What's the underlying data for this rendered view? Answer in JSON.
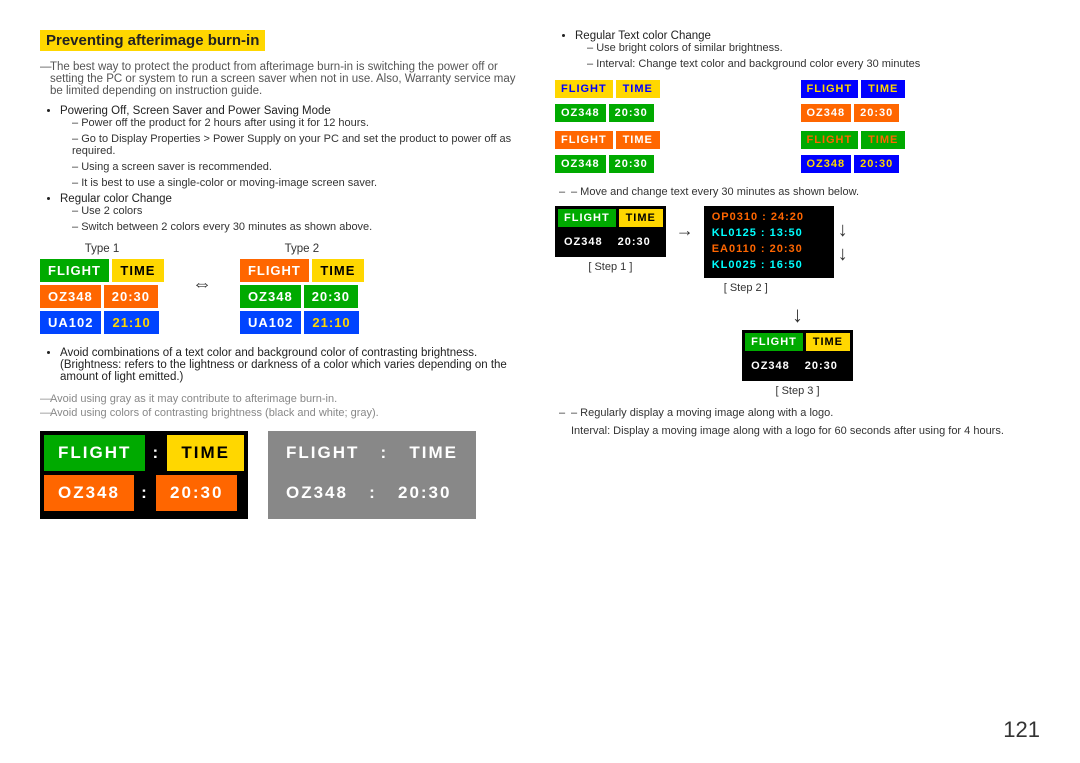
{
  "page": {
    "number": "121"
  },
  "section": {
    "title": "Preventing afterimage burn-in",
    "intro": "The best way to protect the product from afterimage burn-in is switching the power off or setting the PC or system to run a screen saver when not in use. Also, Warranty service may be limited depending on instruction guide.",
    "bullets": [
      {
        "text": "Powering Off, Screen Saver and Power Saving Mode",
        "sub": [
          "Power off the product for 2 hours after using it for 12 hours.",
          "Go to Display Properties > Power Supply on your PC and set the product to power off as required.",
          "Using a screen saver is recommended.",
          "It is best to use a single-color or moving-image screen saver."
        ]
      },
      {
        "text": "Regular color Change",
        "sub": [
          "Use 2 colors",
          "Switch between 2 colors every 30 minutes as shown above."
        ]
      }
    ],
    "avoidance_notes": [
      "Avoid combinations of a text color and background color of contrasting brightness. (Brightness: refers to the lightness or darkness of a color which varies depending on the amount of light emitted.)",
      "Avoid using gray as it may contribute to afterimage burn-in.",
      "Avoid using colors of contrasting brightness (black and white; gray)."
    ]
  },
  "type_labels": {
    "type1": "Type 1",
    "type2": "Type 2"
  },
  "boards": {
    "type1": {
      "row1": [
        "FLIGHT",
        "TIME"
      ],
      "row2": [
        "OZ348",
        "20:30"
      ],
      "row3": [
        "UA102",
        "21:10"
      ],
      "row1_colors": [
        "#00AA00",
        "#FFD700"
      ],
      "row2_colors": [
        "#FF6600",
        "#FF6600"
      ],
      "row3_colors": [
        "#0044FF",
        "#0044FF"
      ],
      "row1_text_colors": [
        "#fff",
        "#000"
      ],
      "row2_text_colors": [
        "#fff",
        "#fff"
      ],
      "row3_text_colors": [
        "#fff",
        "#FFD700"
      ]
    },
    "type2": {
      "row1": [
        "FLIGHT",
        "TIME"
      ],
      "row2": [
        "OZ348",
        "20:30"
      ],
      "row3": [
        "UA102",
        "21:10"
      ],
      "row1_colors": [
        "#FF6600",
        "#FFD700"
      ],
      "row2_colors": [
        "#00AA00",
        "#00AA00"
      ],
      "row3_colors": [
        "#0044FF",
        "#0044FF"
      ],
      "row1_text_colors": [
        "#fff",
        "#000"
      ],
      "row2_text_colors": [
        "#fff",
        "#fff"
      ],
      "row3_text_colors": [
        "#fff",
        "#FFD700"
      ]
    }
  },
  "bottom_boards": {
    "board1": {
      "bg": "#000",
      "row1": [
        "FLIGHT",
        ":",
        "TIME"
      ],
      "row2": [
        "OZ348",
        ":",
        "20:30"
      ],
      "row1_colors": [
        "#00AA00",
        "#000",
        "#FFD700"
      ],
      "row2_colors": [
        "#FF6600",
        "#000",
        "#FF6600"
      ],
      "row1_text": [
        "#fff",
        "#fff",
        "#000"
      ],
      "row2_text": [
        "#fff",
        "#fff",
        "#fff"
      ]
    },
    "board2": {
      "bg": "#888",
      "row1": [
        "FLIGHT",
        ":",
        "TIME"
      ],
      "row2": [
        "OZ348",
        ":",
        "20:30"
      ],
      "row1_colors": [
        "#888",
        "#888",
        "#888"
      ],
      "row2_colors": [
        "#888",
        "#888",
        "#888"
      ],
      "row1_text": [
        "#fff",
        "#fff",
        "#fff"
      ],
      "row2_text": [
        "#fff",
        "#fff",
        "#fff"
      ]
    }
  },
  "right": {
    "bullet": {
      "text": "Regular Text color Change",
      "sub": [
        "Use bright colors of similar brightness.",
        "Interval: Change text color and background color every 30 minutes"
      ]
    },
    "color_boards": [
      {
        "row1_bg": [
          "#FFD700",
          "#FFD700"
        ],
        "row1_text": [
          "#0000FF",
          "#0000FF"
        ],
        "row1_label": [
          "FLIGHT",
          "TIME"
        ],
        "row2_bg": [
          "#00AA00",
          "#00AA00"
        ],
        "row2_text": [
          "#fff",
          "#fff"
        ],
        "row2_label": [
          "OZ348",
          "20:30"
        ]
      },
      {
        "row1_bg": [
          "#0000FF",
          "#0000FF"
        ],
        "row1_text": [
          "#FFD700",
          "#FFD700"
        ],
        "row1_label": [
          "FLIGHT",
          "TIME"
        ],
        "row2_bg": [
          "#FF6600",
          "#FF6600"
        ],
        "row2_text": [
          "#fff",
          "#fff"
        ],
        "row2_label": [
          "OZ348",
          "20:30"
        ]
      },
      {
        "row1_bg": [
          "#FF6600",
          "#FF6600"
        ],
        "row1_text": [
          "#fff",
          "#fff"
        ],
        "row1_label": [
          "FLIGHT",
          "TIME"
        ],
        "row2_bg": [
          "#00AA00",
          "#00AA00"
        ],
        "row2_text": [
          "#fff",
          "#fff"
        ],
        "row2_label": [
          "OZ348",
          "20:30"
        ]
      },
      {
        "row1_bg": [
          "#00AA00",
          "#00AA00"
        ],
        "row1_text": [
          "#FF6600",
          "#FF6600"
        ],
        "row1_label": [
          "FLIGHT",
          "TIME"
        ],
        "row2_bg": [
          "#0000FF",
          "#0000FF"
        ],
        "row2_text": [
          "#FFD700",
          "#FFD700"
        ],
        "row2_label": [
          "OZ348",
          "20:30"
        ]
      }
    ],
    "move_note": "– Move and change text every 30 minutes as shown below.",
    "steps": {
      "step1_label": "[ Step 1 ]",
      "step2_label": "[ Step 2 ]",
      "step3_label": "[ Step 3 ]",
      "step1_board": {
        "row1": [
          "FLIGHT",
          "TIME"
        ],
        "row2": [
          "OZ348",
          "20:30"
        ],
        "row1_bg": [
          "#00AA00",
          "#FFD700"
        ],
        "row2_bg": [
          "#000",
          "#000"
        ],
        "row1_text": [
          "#fff",
          "#000"
        ],
        "row2_text": [
          "#fff",
          "#fff"
        ]
      },
      "step2_lines": [
        {
          "text": "OP0310 : 24:20",
          "color": "#FF6600",
          "bg": "#000"
        },
        {
          "text": "KL0125 : 13:50",
          "color": "#00FFFF",
          "bg": "#000"
        },
        {
          "text": "EA0110 : 20:30",
          "color": "#FF6600",
          "bg": "#000"
        },
        {
          "text": "KL0025 : 16:50",
          "color": "#00FFFF",
          "bg": "#000"
        }
      ],
      "step3_board": {
        "row1": [
          "FLIGHT",
          "TIME"
        ],
        "row2": [
          "OZ348",
          "20:30"
        ],
        "row1_bg": [
          "#00AA00",
          "#FFD700"
        ],
        "row2_bg": [
          "#000",
          "#000"
        ],
        "row1_text": [
          "#fff",
          "#000"
        ],
        "row2_text": [
          "#fff",
          "#fff"
        ]
      }
    },
    "logo_note": "– Regularly display a moving image along with a logo.",
    "logo_sub": "Interval: Display a moving image along with a logo for 60 seconds after using for 4 hours."
  }
}
